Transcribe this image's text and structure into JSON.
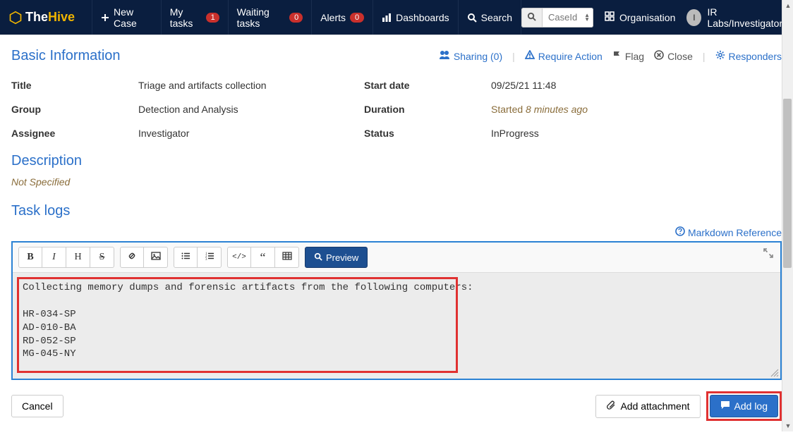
{
  "app": {
    "logo_the": "The",
    "logo_hive": "Hive"
  },
  "nav": {
    "new_case": "New Case",
    "my_tasks": "My tasks",
    "my_tasks_badge": "1",
    "waiting_tasks": "Waiting tasks",
    "waiting_tasks_badge": "0",
    "alerts": "Alerts",
    "alerts_badge": "0",
    "dashboards": "Dashboards",
    "search": "Search"
  },
  "search": {
    "placeholder": "CaseId"
  },
  "topright": {
    "organisation": "Organisation",
    "user": "IR Labs/Investigator",
    "user_initial": "I"
  },
  "section": {
    "basic_info": "Basic Information",
    "description": "Description",
    "task_logs": "Task logs"
  },
  "actions": {
    "sharing": "Sharing (0)",
    "require_action": "Require Action",
    "flag": "Flag",
    "close": "Close",
    "responders": "Responders"
  },
  "info": {
    "title_label": "Title",
    "title": "Triage and artifacts collection",
    "group_label": "Group",
    "group": "Detection and Analysis",
    "assignee_label": "Assignee",
    "assignee": "Investigator",
    "start_label": "Start date",
    "start": "09/25/21 11:48",
    "duration_label": "Duration",
    "duration_prefix": "Started ",
    "duration_em": "8 minutes ago",
    "status_label": "Status",
    "status": "InProgress"
  },
  "description": {
    "value": "Not Specified"
  },
  "markdown_ref": "Markdown Reference",
  "toolbar": {
    "preview": "Preview"
  },
  "editor": {
    "content": "Collecting memory dumps and forensic artifacts from the following computers:\n\nHR-034-SP\nAD-010-BA\nRD-052-SP\nMG-045-NY"
  },
  "footer": {
    "cancel": "Cancel",
    "add_attachment": "Add attachment",
    "add_log": "Add log"
  }
}
